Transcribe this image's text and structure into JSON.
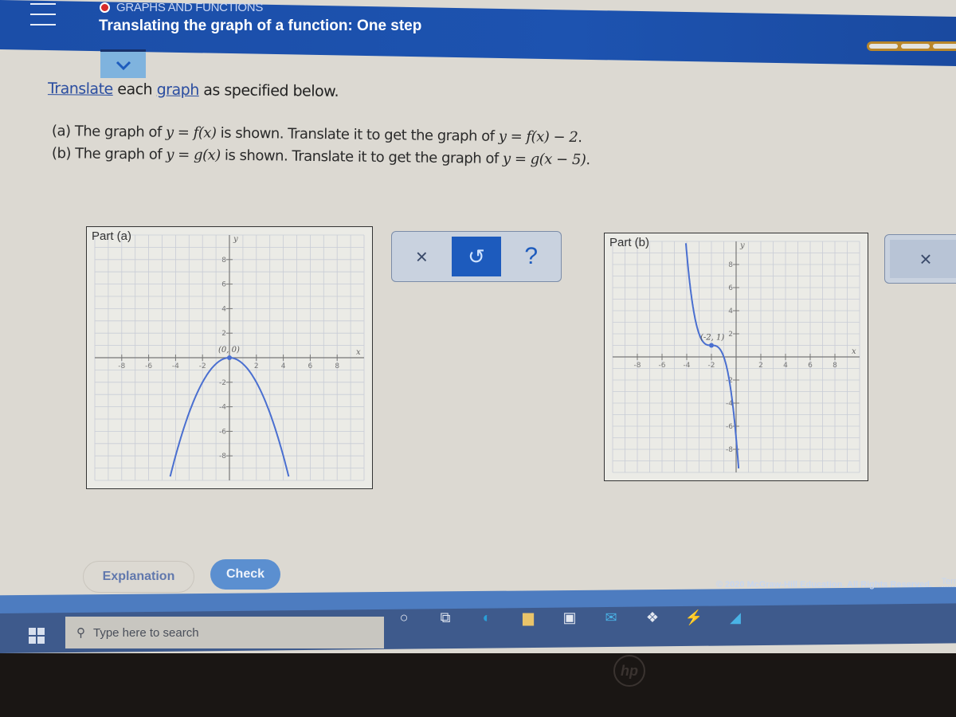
{
  "header": {
    "topic": "GRAPHS AND FUNCTIONS",
    "title": "Translating the graph of a function: One step",
    "progress_segments": 3
  },
  "instructions": {
    "link1": "Translate",
    "middle1": " each ",
    "link2": "graph",
    "tail": " as specified below."
  },
  "questions": [
    {
      "prefix": "(a) The graph of ",
      "fn1": "y = f(x)",
      "middle": " is shown. Translate it to get the graph of ",
      "fn2": "y = f(x) − 2",
      "suffix": "."
    },
    {
      "prefix": "(b) The graph of ",
      "fn1": "y = g(x)",
      "middle": " is shown. Translate it to get the graph of ",
      "fn2": "y = g(x − 5)",
      "suffix": "."
    }
  ],
  "toolbar": {
    "clear_icon": "close-icon",
    "undo_icon": "undo-icon",
    "help_label": "?",
    "clear_label": "×",
    "undo_label": "↺"
  },
  "toolbar_b": {
    "clear_label": "×"
  },
  "buttons": {
    "explanation": "Explanation",
    "check": "Check"
  },
  "footer": {
    "copyright": "© 2020 McGraw-Hill Education. All Rights Reserved.",
    "terms": "Term"
  },
  "taskbar": {
    "search_placeholder": "Type here to search",
    "icons": [
      "cortana-icon",
      "task-view-icon",
      "edge-icon",
      "file-explorer-icon",
      "store-icon",
      "mail-icon",
      "dropbox-icon",
      "app-icon",
      "app2-icon"
    ]
  },
  "laptop_logo": "hp",
  "chart_data": [
    {
      "type": "line",
      "title": "Part (a)",
      "xlabel": "x",
      "ylabel": "y",
      "xlim": [
        -10,
        10
      ],
      "ylim": [
        -10,
        10
      ],
      "xticks": [
        -8,
        -6,
        -4,
        -2,
        2,
        4,
        6,
        8
      ],
      "yticks": [
        -8,
        -6,
        -4,
        -2,
        2,
        4,
        6,
        8
      ],
      "grid": true,
      "series": [
        {
          "name": "f(x)",
          "function": "-x^2/2",
          "x": [
            -4.4,
            -4,
            -3,
            -2,
            -1,
            0,
            1,
            2,
            3,
            4,
            4.4
          ],
          "y": [
            -9.68,
            -8,
            -4.5,
            -2,
            -0.5,
            0,
            -0.5,
            -2,
            -4.5,
            -8,
            -9.68
          ]
        }
      ],
      "annotations": [
        {
          "text": "(0, 0)",
          "x": 0,
          "y": 0
        }
      ]
    },
    {
      "type": "line",
      "title": "Part (b)",
      "xlabel": "x",
      "ylabel": "y",
      "xlim": [
        -10,
        10
      ],
      "ylim": [
        -10,
        10
      ],
      "xticks": [
        -8,
        -6,
        -4,
        -2,
        2,
        4,
        6,
        8
      ],
      "yticks": [
        -8,
        -6,
        -4,
        -2,
        2,
        4,
        6,
        8
      ],
      "grid": true,
      "series": [
        {
          "name": "g(x)",
          "function": "-(x+2)^3+1",
          "x": [
            -4.2,
            -4,
            -3.5,
            -3,
            -2.5,
            -2,
            -1.5,
            -1,
            -0.5,
            0,
            0.2
          ],
          "y": [
            11.6,
            9,
            4.4,
            2,
            1.1,
            1,
            0.9,
            0,
            -2.4,
            -7,
            -9.6
          ]
        }
      ],
      "annotations": [
        {
          "text": "(-2, 1)",
          "x": -2,
          "y": 1
        }
      ]
    }
  ]
}
